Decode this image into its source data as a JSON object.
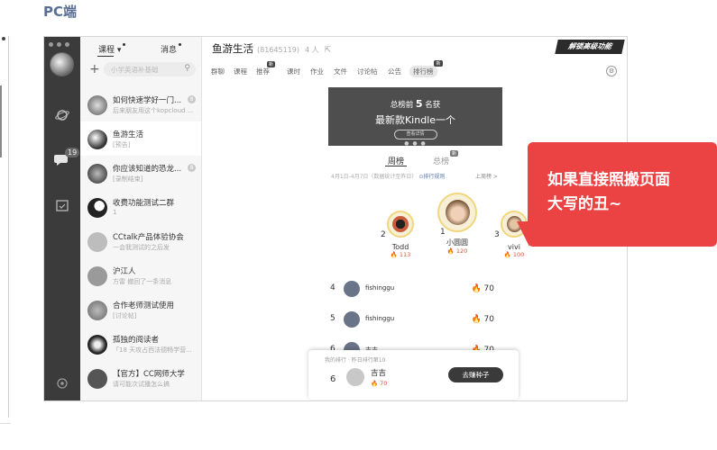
{
  "heading": "PC端",
  "nav": {
    "badge": "19"
  },
  "list": {
    "tab_course": "课程",
    "tab_message": "消息",
    "search_placeholder": "小学英语补基础",
    "items": [
      {
        "title": "如何快速学好一门...",
        "sub": "后来朋友用这个kopcloud ...",
        "badge": "8"
      },
      {
        "title": "鱼游生活",
        "sub": "[预告]",
        "badge": ""
      },
      {
        "title": "你应该知道的恐龙...",
        "sub": "[录制结束]",
        "badge": "8"
      },
      {
        "title": "收费功能测试二群",
        "sub": "1",
        "badge": "8"
      },
      {
        "title": "CCtalk产品体验协会",
        "sub": "一会我测试的之后发",
        "badge": "8"
      },
      {
        "title": "沪江人",
        "sub": "方雷 撤回了一条消息",
        "badge": "8"
      },
      {
        "title": "合作老师测试使用",
        "sub": "[讨论帖]",
        "badge": ""
      },
      {
        "title": "孤独的阅读者",
        "sub": "「18 天攻占西法德畅学营...",
        "badge": "8"
      },
      {
        "title": "【官方】CC网师大学",
        "sub": "请可能次试播怎么搞",
        "badge": "8"
      }
    ]
  },
  "main": {
    "title": "鱼游生活",
    "group_id": "(81645119)",
    "member_count": "4 人",
    "logo_text": "解锁高级功能",
    "tabs": [
      "群聊",
      "课程",
      "推荐",
      "课时",
      "作业",
      "文件",
      "讨论帖",
      "公告",
      "排行榜"
    ],
    "tab_mark_recommend": "新",
    "tab_mark_rank": "新",
    "banner": {
      "line1_a": "总榜前",
      "line1_num": "5",
      "line1_b": "名获",
      "line2": "最新款Kindle一个",
      "button": "查看详情"
    },
    "rank_tab_week": "周榜",
    "rank_tab_total": "总榜",
    "rank_tab_total_badge": "新",
    "date_text": "4月1日-4月7日（数据统计至昨日）",
    "rule_text": "⊙排行规则",
    "last_week": "上周榜 >",
    "podium": [
      {
        "rank": "2",
        "name": "Todd",
        "score": "113"
      },
      {
        "rank": "1",
        "name": "小圆圆",
        "score": "120"
      },
      {
        "rank": "3",
        "name": "vivi",
        "score": "100"
      }
    ],
    "rows": [
      {
        "rank": "4",
        "name": "fishinggu",
        "score": "70"
      },
      {
        "rank": "5",
        "name": "fishinggu",
        "score": "70"
      },
      {
        "rank": "6",
        "name": "吉吉",
        "score": "70"
      }
    ],
    "mine": {
      "label": "我的排行 · 昨日排行第10",
      "rank": "6",
      "name": "吉吉",
      "score": "70",
      "button": "去赚种子"
    }
  },
  "callout": {
    "line1": "如果直接照搬页面",
    "line2": "大写的丑~"
  },
  "colors": {
    "accent_red": "#eb4343",
    "nav_dark": "#3b3b3b",
    "heading_blue": "#5a6f93"
  }
}
